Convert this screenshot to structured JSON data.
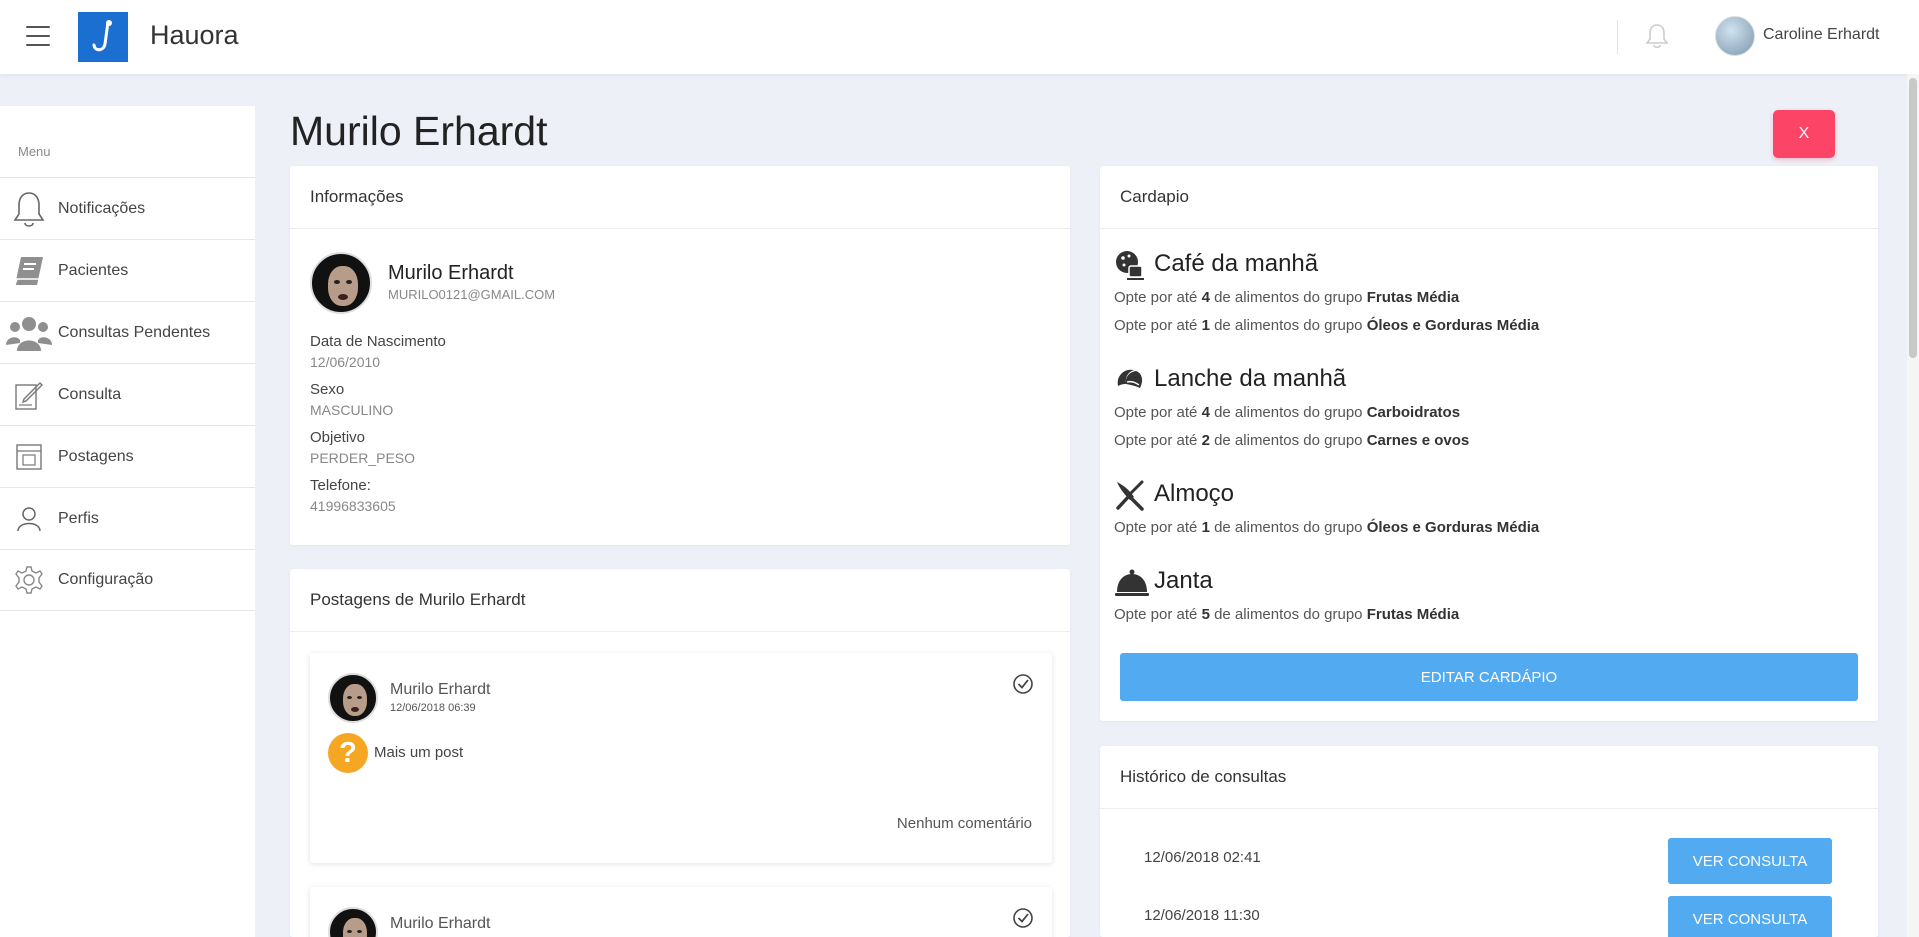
{
  "app": {
    "title": "Hauora"
  },
  "user": {
    "name": "Caroline Erhardt"
  },
  "sidebar": {
    "caption": "Menu",
    "items": [
      {
        "label": "Notificações",
        "icon": "bell-icon"
      },
      {
        "label": "Pacientes",
        "icon": "book-icon"
      },
      {
        "label": "Consultas Pendentes",
        "icon": "users-icon"
      },
      {
        "label": "Consulta",
        "icon": "edit-note-icon"
      },
      {
        "label": "Postagens",
        "icon": "post-icon"
      },
      {
        "label": "Perfis",
        "icon": "user-icon"
      },
      {
        "label": "Configuração",
        "icon": "gear-icon"
      }
    ]
  },
  "page": {
    "title": "Murilo Erhardt",
    "close_label": "X"
  },
  "info": {
    "header": "Informações",
    "name": "Murilo Erhardt",
    "email": "MURILO0121@GMAIL.COM",
    "fields": [
      {
        "label": "Data de Nascimento",
        "value": "12/06/2010"
      },
      {
        "label": "Sexo",
        "value": "MASCULINO"
      },
      {
        "label": "Objetivo",
        "value": "PERDER_PESO"
      },
      {
        "label": "Telefone:",
        "value": "41996833605"
      }
    ]
  },
  "posts": {
    "header": "Postagens de Murilo Erhardt",
    "items": [
      {
        "author": "Murilo Erhardt",
        "date": "12/06/2018 06:39",
        "text": "Mais um post",
        "comments": "Nenhum comentário"
      },
      {
        "author": "Murilo Erhardt"
      }
    ]
  },
  "menu": {
    "header": "Cardapio",
    "prefix": "Opte por até",
    "mid": "de alimentos do grupo",
    "meals": [
      {
        "title": "Café da manhã",
        "icon": "coffee-cookie-icon",
        "lines": [
          {
            "qty": "4",
            "group": "Frutas Média"
          },
          {
            "qty": "1",
            "group": "Óleos e Gorduras Média"
          }
        ]
      },
      {
        "title": "Lanche da manhã",
        "icon": "croissant-icon",
        "lines": [
          {
            "qty": "4",
            "group": "Carboidratos"
          },
          {
            "qty": "2",
            "group": "Carnes e ovos"
          }
        ]
      },
      {
        "title": "Almoço",
        "icon": "utensils-icon",
        "lines": [
          {
            "qty": "1",
            "group": "Óleos e Gorduras Média"
          }
        ]
      },
      {
        "title": "Janta",
        "icon": "cloche-icon",
        "lines": [
          {
            "qty": "5",
            "group": "Frutas Média"
          }
        ]
      }
    ],
    "edit_label": "EDITAR CARDÁPIO"
  },
  "history": {
    "header": "Histórico de consultas",
    "items": [
      {
        "date": "12/06/2018 02:41",
        "button": "VER CONSULTA"
      },
      {
        "date": "12/06/2018 11:30",
        "button": "VER CONSULTA"
      }
    ]
  },
  "colors": {
    "accent": "#52aaf0",
    "danger": "#fb4466",
    "brand": "#1a6fd1",
    "background": "#edf0f7"
  }
}
